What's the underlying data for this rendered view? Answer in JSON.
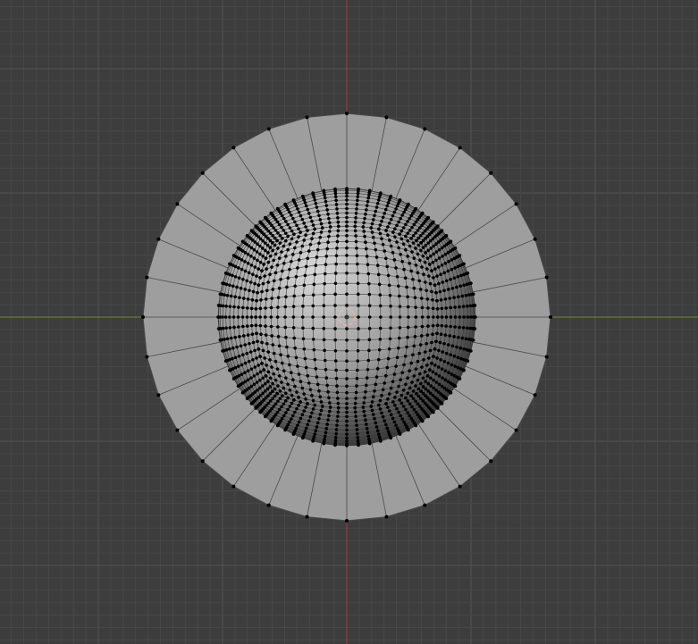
{
  "viewport": {
    "view": "top-orthographic",
    "colors": {
      "background": "#3d3d3d",
      "grid_minor": "#474747",
      "grid_major": "#525252",
      "x_axis": "#9b3a45",
      "y_axis": "#6a8a2e",
      "mesh_face": "#9e9e9e",
      "mesh_edge": "#4a4a4a",
      "vertex": "#000000",
      "origin": "#e8b4a8"
    },
    "mesh": {
      "ring_segments": 32,
      "sphere_subdivisions": 22
    }
  }
}
